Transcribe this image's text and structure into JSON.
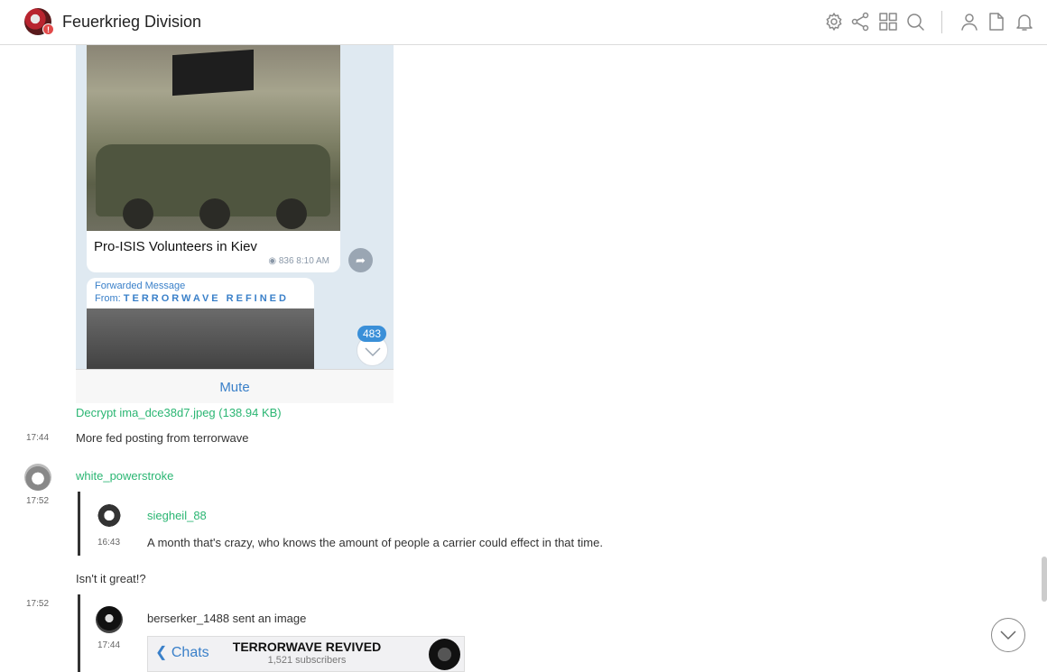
{
  "app": {
    "title": "Feuerkrieg Division",
    "badge": "!"
  },
  "toolbar": {
    "icons": [
      "settings-icon",
      "share-icon",
      "grid-icon",
      "search-icon",
      "user-icon",
      "document-icon",
      "bell-icon"
    ]
  },
  "screenshot1": {
    "caption": "Pro-ISIS Volunteers in Kiev",
    "meta": "836 8:10 AM",
    "forward_label": "Forwarded Message",
    "forward_from_prefix": "From:",
    "forward_from_channel": "TERRORWAVE REFINED",
    "unread_count": "483",
    "mute_label": "Mute"
  },
  "messages": [
    {
      "decrypt_link": "Decrypt ima_dce38d7.jpeg (138.94 KB)",
      "time": "17:44",
      "text": "More fed posting from terrorwave"
    },
    {
      "username": "white_powerstroke",
      "time": "17:52",
      "quote": {
        "username": "siegheil_88",
        "time": "16:43",
        "text": "A month that's crazy, who knows the amount of people a carrier could effect in that time."
      },
      "text": "Isn't it great!?"
    },
    {
      "time": "17:52",
      "quote": {
        "time": "17:44",
        "text": "berserker_1488 sent an image"
      }
    }
  ],
  "screenshot2": {
    "back_label": "Chats",
    "title": "TERRORWAVE REVIVED",
    "subtitle": "1,521 subscribers"
  }
}
